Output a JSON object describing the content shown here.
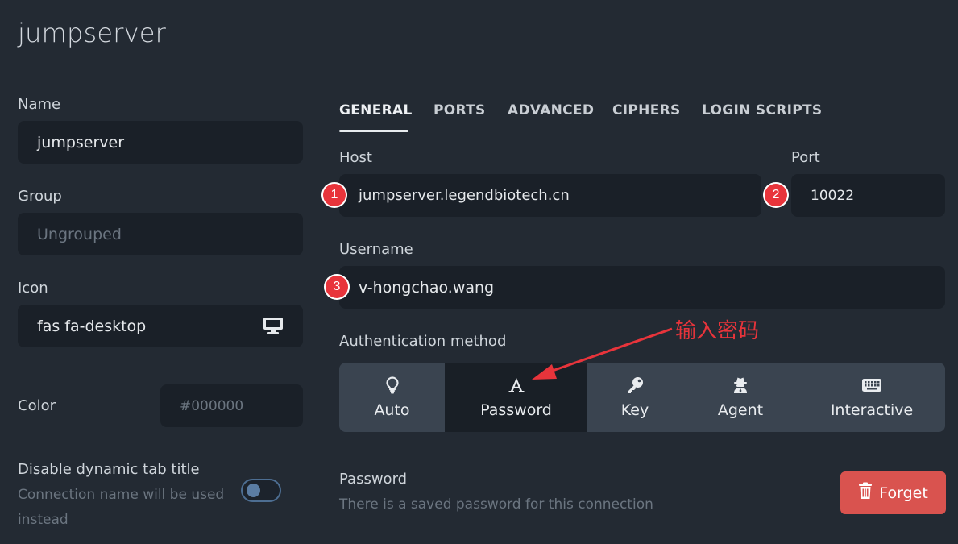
{
  "page": {
    "title": "jumpserver"
  },
  "left": {
    "name": {
      "label": "Name",
      "value": "jumpserver"
    },
    "group": {
      "label": "Group",
      "placeholder": "Ungrouped"
    },
    "icon": {
      "label": "Icon",
      "value": "fas fa-desktop",
      "icon_name": "desktop-icon"
    },
    "color": {
      "label": "Color",
      "placeholder": "#000000"
    },
    "dynamic_title": {
      "label": "Disable dynamic tab title",
      "hint_line1": "Connection name will be used",
      "hint_line2": "instead",
      "enabled": false
    }
  },
  "tabs": [
    {
      "label": "GENERAL",
      "active": true
    },
    {
      "label": "PORTS",
      "active": false
    },
    {
      "label": "ADVANCED",
      "active": false
    },
    {
      "label": "CIPHERS",
      "active": false
    },
    {
      "label": "LOGIN SCRIPTS",
      "active": false
    }
  ],
  "general": {
    "host": {
      "label": "Host",
      "value": "jumpserver.legendbiotech.cn"
    },
    "port": {
      "label": "Port",
      "value": "10022"
    },
    "username": {
      "label": "Username",
      "value": "v-hongchao.wang"
    },
    "auth": {
      "label": "Authentication method",
      "options": [
        {
          "label": "Auto",
          "icon": "lightbulb-icon",
          "selected": false
        },
        {
          "label": "Password",
          "icon": "font-a-icon",
          "selected": true
        },
        {
          "label": "Key",
          "icon": "key-icon",
          "selected": false
        },
        {
          "label": "Agent",
          "icon": "user-secret-icon",
          "selected": false
        },
        {
          "label": "Interactive",
          "icon": "keyboard-icon",
          "selected": false
        }
      ]
    },
    "password": {
      "label": "Password",
      "hint": "There is a saved password for this connection",
      "forget_label": "Forget"
    }
  },
  "annotations": {
    "badges": [
      "1",
      "2",
      "3"
    ],
    "note": "输入密码",
    "color": "#e8343b"
  },
  "colors": {
    "background": "#232a33",
    "field": "#1a2028",
    "forget": "#d9534f",
    "toggle": "#5b7da3"
  }
}
